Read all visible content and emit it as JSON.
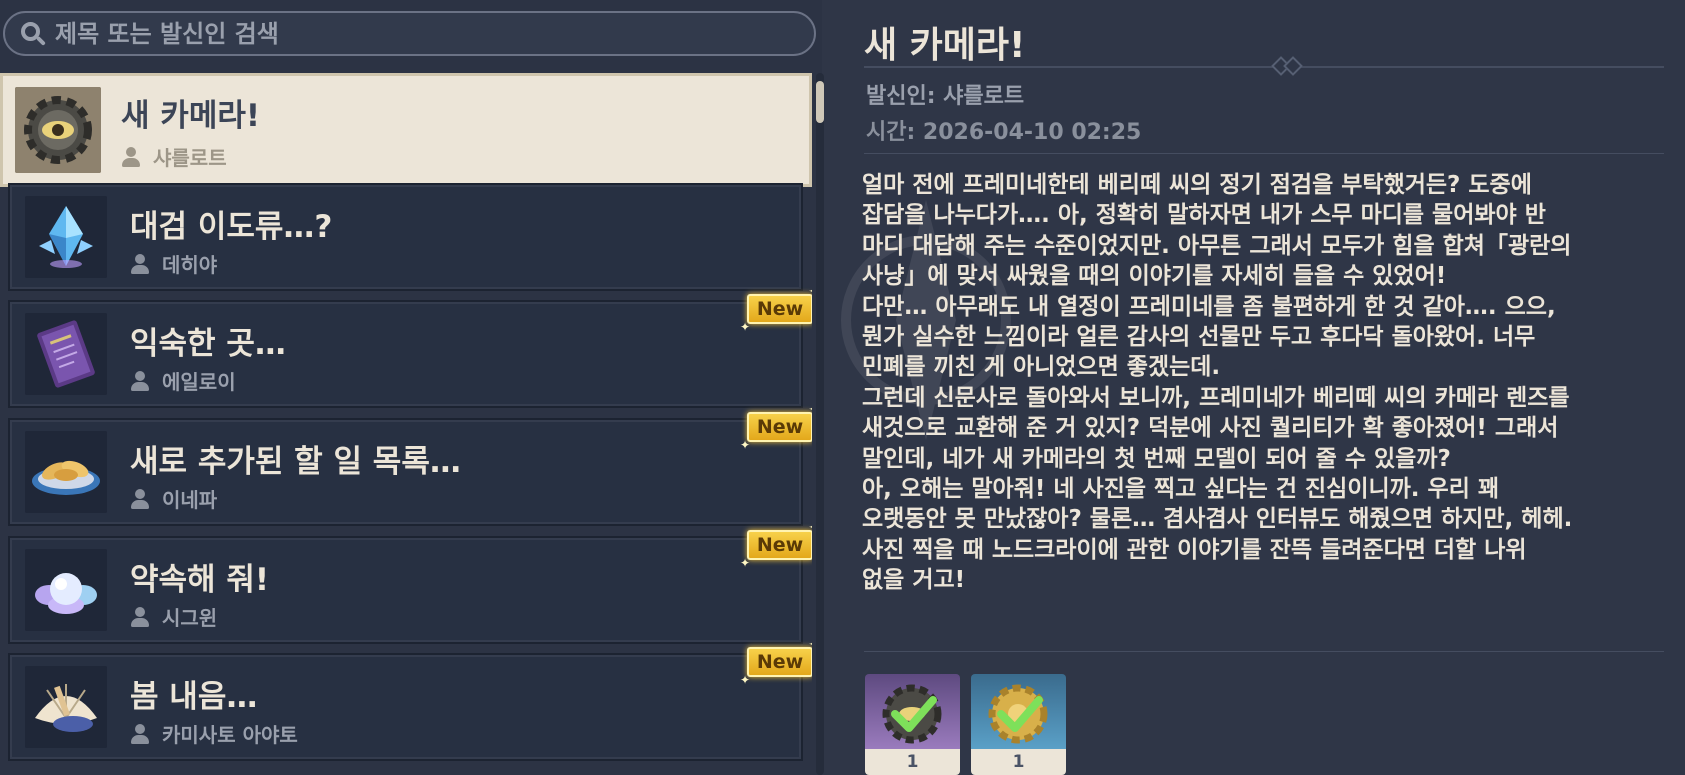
{
  "search": {
    "placeholder": "제목 또는 발신인 검색"
  },
  "mails": [
    {
      "title": "새 카메라!",
      "sender": "샤를로트",
      "selected": true,
      "new": false,
      "icon": "gear-eye-icon"
    },
    {
      "title": "대검 이도류…?",
      "sender": "데히야",
      "selected": false,
      "new": false,
      "icon": "crystal-icon"
    },
    {
      "title": "익숙한 곳…",
      "sender": "에일로이",
      "selected": false,
      "new": true,
      "icon": "purple-book-icon"
    },
    {
      "title": "새로 추가된 할 일 목록…",
      "sender": "이네파",
      "selected": false,
      "new": true,
      "icon": "dish-icon"
    },
    {
      "title": "약속해 줘!",
      "sender": "시그윈",
      "selected": false,
      "new": true,
      "icon": "pearl-flower-icon"
    },
    {
      "title": "봄 내음…",
      "sender": "카미사토 아야토",
      "selected": false,
      "new": true,
      "icon": "fan-icon"
    }
  ],
  "new_label": "New",
  "detail": {
    "title": "새 카메라!",
    "sender_line": "발신인: 샤를로트",
    "time_line": "시간: 2026-04-10 02:25",
    "body": "얼마 전에 프레미네한테 베리떼 씨의 정기 점검을 부탁했거든? 도중에\n잡담을 나누다가…. 아, 정확히 말하자면 내가 스무 마디를 물어봐야 반\n마디 대답해 주는 수준이었지만. 아무튼 그래서 모두가 힘을 합쳐「광란의\n사냥」에 맞서 싸웠을 때의 이야기를 자세히 들을 수 있었어!\n다만… 아무래도 내 열정이 프레미네를 좀 불편하게 한 것 같아…. 으으,\n뭔가 실수한 느낌이라 얼른 감사의 선물만 두고 후다닥 돌아왔어. 너무\n민폐를 끼친 게 아니었으면 좋겠는데.\n그런데 신문사로 돌아와서 보니까, 프레미네가 베리떼 씨의 카메라 렌즈를\n새것으로 교환해 준 거 있지? 덕분에 사진 퀄리티가 확 좋아졌어! 그래서\n말인데, 네가 새 카메라의 첫 번째 모델이 되어 줄 수 있을까?\n아, 오해는 말아줘! 네 사진을 찍고 싶다는 건 진심이니까. 우리 꽤\n오랫동안 못 만났잖아? 물론… 겸사겸사 인터뷰도 해줬으면 하지만, 헤헤.\n사진 찍을 때 노드크라이에 관한 이야기를 잔뜩 들려준다면 더할 나위\n없을 거고!",
    "attachments": [
      {
        "icon": "gear-eye-claimed-icon",
        "count": "1"
      },
      {
        "icon": "gold-gear-claimed-icon",
        "count": "1"
      }
    ]
  }
}
